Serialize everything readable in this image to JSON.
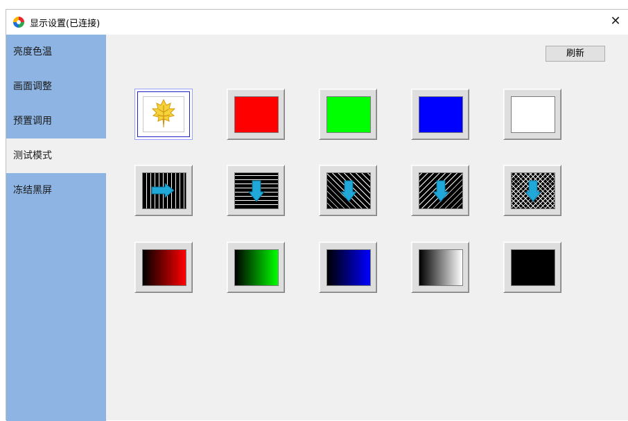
{
  "window": {
    "title": "显示设置(已连接)",
    "close_glyph": "✕",
    "icon": "app-color-wheel-icon"
  },
  "sidebar": {
    "items": [
      {
        "label": "亮度色温"
      },
      {
        "label": "画面调整"
      },
      {
        "label": "预置调用"
      },
      {
        "label": "测试模式",
        "active": true
      },
      {
        "label": "冻结黑屏"
      }
    ]
  },
  "toolbar": {
    "refresh_label": "刷新"
  },
  "patterns": [
    {
      "name": "leaf-logo",
      "selected": true
    },
    {
      "name": "solid-red",
      "color": "#ff0000"
    },
    {
      "name": "solid-green",
      "color": "#00ff00"
    },
    {
      "name": "solid-blue",
      "color": "#0000ff"
    },
    {
      "name": "solid-white",
      "color": "#ffffff"
    },
    {
      "name": "vertical-lines"
    },
    {
      "name": "horizontal-lines"
    },
    {
      "name": "diagonal-lines-right"
    },
    {
      "name": "diagonal-lines-left"
    },
    {
      "name": "crosshatch-grid"
    },
    {
      "name": "gradient-red",
      "color": "#ff0000"
    },
    {
      "name": "gradient-green",
      "color": "#00ff00"
    },
    {
      "name": "gradient-blue",
      "color": "#0000ff"
    },
    {
      "name": "gradient-gray",
      "color": "#ffffff"
    },
    {
      "name": "solid-black",
      "color": "#000000"
    }
  ]
}
